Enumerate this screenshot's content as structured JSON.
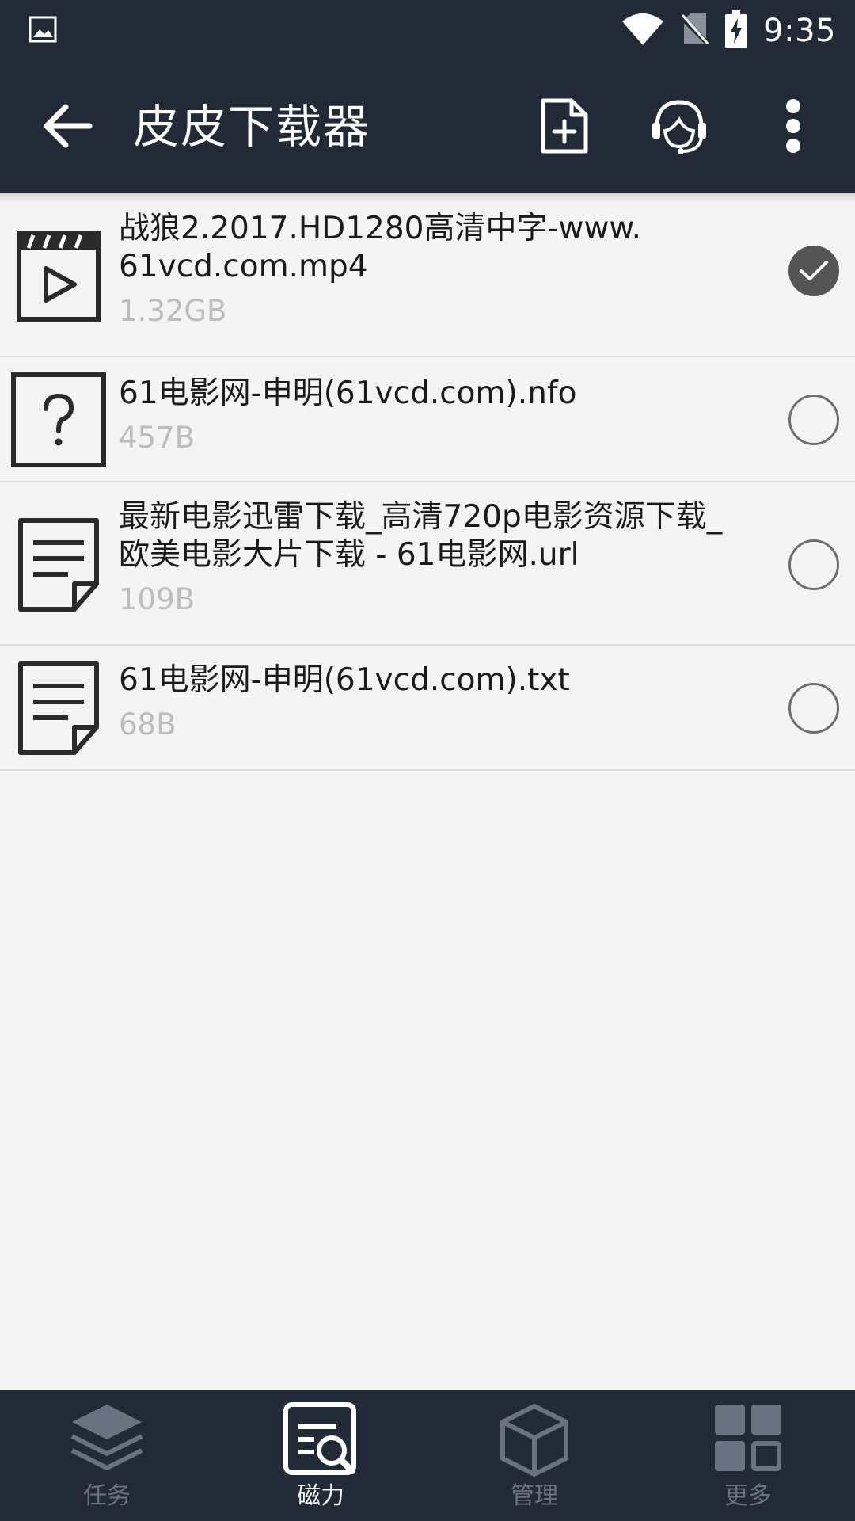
{
  "status_bar": {
    "time": "9:35",
    "icons": [
      "image-notification-icon",
      "wifi-icon",
      "no-sim-icon",
      "battery-charging-icon"
    ]
  },
  "app_bar": {
    "title": "皮皮下载器",
    "actions": [
      "new-file-icon",
      "customer-service-icon",
      "more-vert-icon"
    ]
  },
  "files": [
    {
      "name": "战狼2.2017.HD1280高清中字-www.\n61vcd.com.mp4",
      "size": "1.32GB",
      "icon": "video-file-icon",
      "selected": true
    },
    {
      "name": "61电影网-申明(61vcd.com).nfo",
      "size": "457B",
      "icon": "unknown-file-icon",
      "selected": false
    },
    {
      "name": "最新电影迅雷下载_高清720p电影资源下载_\n欧美电影大片下载 - 61电影网.url",
      "size": "109B",
      "icon": "document-file-icon",
      "selected": false
    },
    {
      "name": "61电影网-申明(61vcd.com).txt",
      "size": "68B",
      "icon": "document-file-icon",
      "selected": false
    }
  ],
  "bottom_nav": [
    {
      "label": "任务",
      "icon": "layers-icon",
      "active": false
    },
    {
      "label": "磁力",
      "icon": "magnet-search-icon",
      "active": true
    },
    {
      "label": "管理",
      "icon": "box-icon",
      "active": false
    },
    {
      "label": "更多",
      "icon": "grid-icon",
      "active": false
    }
  ],
  "colors": {
    "bar_bg": "#232a37",
    "list_bg": "#f4f4f4",
    "divider": "#dcdcdc",
    "size_text": "#bdbdbd",
    "nav_inactive": "#6a7180",
    "checked_radio": "#555555"
  }
}
